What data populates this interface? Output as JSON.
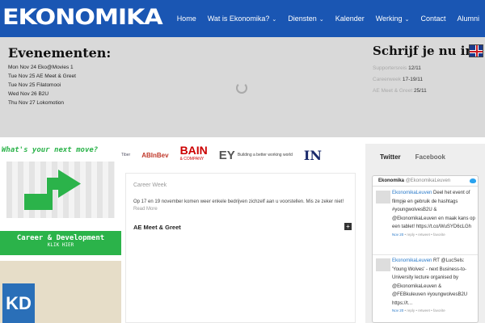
{
  "header": {
    "logo_text": "EKONOMIKA",
    "nav": [
      {
        "label": "Home",
        "caret": ""
      },
      {
        "label": "Wat is Ekonomika?",
        "caret": "⌄"
      },
      {
        "label": "Diensten",
        "caret": "⌄"
      },
      {
        "label": "Kalender",
        "caret": ""
      },
      {
        "label": "Werking",
        "caret": "⌄"
      },
      {
        "label": "Contact",
        "caret": ""
      },
      {
        "label": "Alumni",
        "caret": ""
      }
    ]
  },
  "events": {
    "title": "Evenementen:",
    "items": [
      "Mon Nov 24 Eko@Movies 1",
      "Tue Nov 25 AE Meet & Greet",
      "Tue Nov 25 Filatomooi",
      "Wed Nov 26 B2U",
      "Thu Nov 27 Lokomotion"
    ]
  },
  "subscribe": {
    "title": "Schrijf je nu in!",
    "items": [
      {
        "name": "Supportersreis",
        "date": "12/11"
      },
      {
        "name": "Careerweek",
        "date": "17-19/11"
      },
      {
        "name": "AE Meet & Greet",
        "date": "25/11"
      }
    ]
  },
  "banner": {
    "headline": "What's your next move?",
    "footer_title": "Career & Development",
    "footer_sub": "KLIK HIER",
    "photo_logo": "KD"
  },
  "logos": {
    "first_small": "Tiber",
    "abinbev": "ABInBev",
    "bain": "BAIN",
    "bain_sub": "& COMPANY",
    "ey": "EY",
    "ey_sub": "Building a better working world",
    "last": "IN"
  },
  "content": {
    "career_title": "Career Week",
    "career_text": "Op 17 en 19 november komen weer enkele bedrijven zichzelf aan u voorstellen. Mis ze zeker niet!",
    "read_more": "Read More",
    "ae_title": "AE Meet & Greet",
    "plus": "+"
  },
  "social": {
    "tabs": [
      "Twitter",
      "Facebook"
    ],
    "widget_name": "Ekonomika",
    "widget_handle": "@EkonomikaLeuven",
    "tweets": [
      {
        "text_link": "EkonomikaLeuven",
        "text": " Deel het event of filmpje en gebruik de hashtags #youngwolvesB2U & @EkonomikaLeuven en maak kans op een tablet! https://t.co/WuSYD6cLGh",
        "date": "Nov 20",
        "actions": " • reply • retweet • favorite"
      },
      {
        "text_link": "EkonomikaLeuven",
        "text": " RT @LucSels: 'Young Wolves' - next Business-to-University lecture organised by @EkonomikaLeuven & @FEBkuleuven #youngwolvesB2U https://t…",
        "date": "Nov 20",
        "actions": " • reply • retweet • favorite"
      }
    ]
  },
  "colors": {
    "brand_blue": "#1a56b3",
    "career_green": "#2bb34a"
  }
}
